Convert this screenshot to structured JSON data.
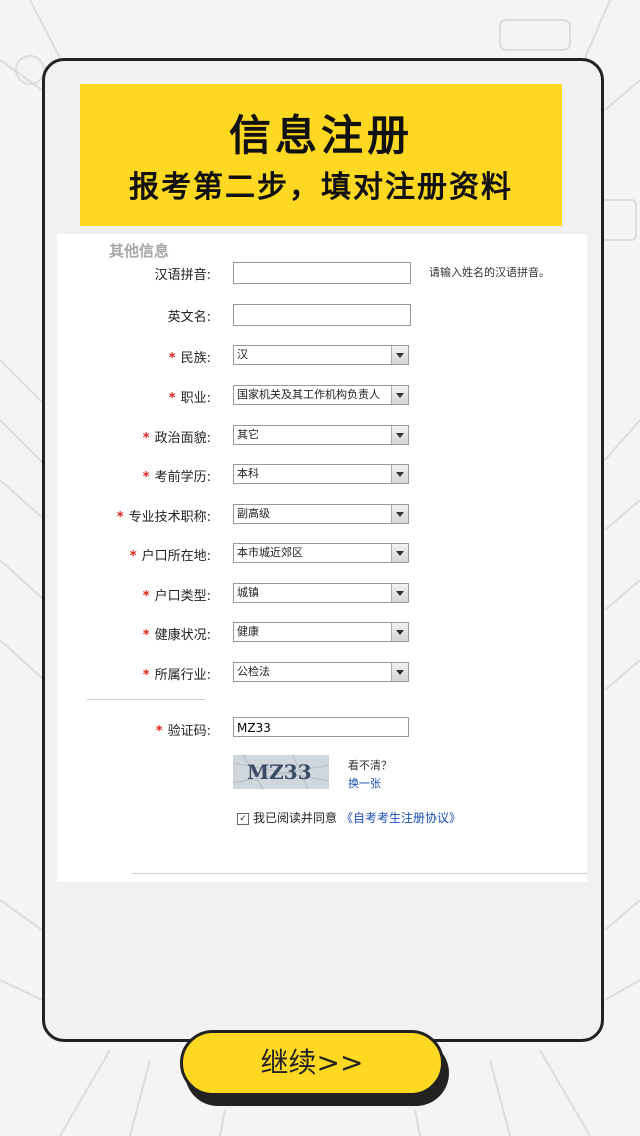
{
  "banner": {
    "title": "信息注册",
    "subtitle": "报考第二步，填对注册资料"
  },
  "form": {
    "section_title": "其他信息",
    "pinyin": {
      "label": "汉语拼音:",
      "value": "",
      "hint": "请输入姓名的汉语拼音。"
    },
    "english_name": {
      "label": "英文名:",
      "value": ""
    },
    "required_mark": "*",
    "ethnicity": {
      "label": "民族:",
      "value": "汉"
    },
    "occupation": {
      "label": "职业:",
      "value": "国家机关及其工作机构负责人"
    },
    "political": {
      "label": "政治面貌:",
      "value": "其它"
    },
    "education": {
      "label": "考前学历:",
      "value": "本科"
    },
    "title_rank": {
      "label": "专业技术职称:",
      "value": "副高级"
    },
    "hukou_location": {
      "label": "户口所在地:",
      "value": "本市城近郊区"
    },
    "hukou_type": {
      "label": "户口类型:",
      "value": "城镇"
    },
    "health": {
      "label": "健康状况:",
      "value": "健康"
    },
    "industry": {
      "label": "所属行业:",
      "value": "公检法"
    },
    "captcha": {
      "label": "验证码:",
      "value": "MZ33",
      "image_text": "MZ33",
      "unclear": "看不清？",
      "refresh": "换一张"
    },
    "agreement": {
      "checked": true,
      "text": "我已阅读并同意",
      "link": "《自考考生注册协议》"
    }
  },
  "continue_button": "继续>>",
  "colors": {
    "accent_yellow": "#ffd921",
    "required_red": "#d9241b",
    "link_blue": "#1a4fb3"
  }
}
